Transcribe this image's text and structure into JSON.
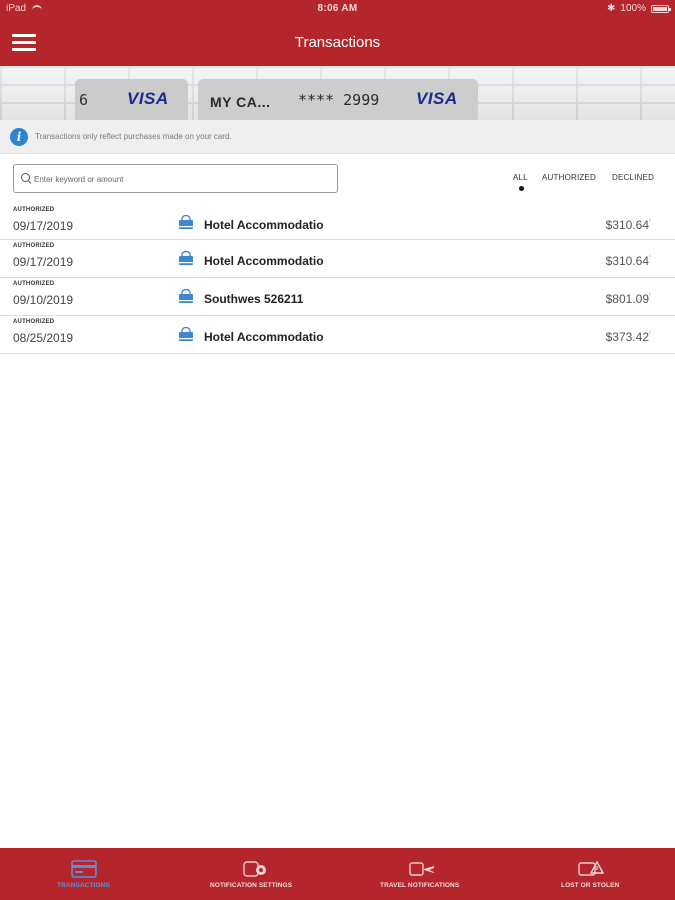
{
  "status_bar": {
    "device": "iPad",
    "time": "8:06 AM",
    "battery": "100%"
  },
  "nav": {
    "title": "Transactions"
  },
  "cards": {
    "previous": {
      "last_digit": "6",
      "brand": "VISA"
    },
    "current": {
      "name": "MY CA...",
      "number": "**** 2999",
      "brand": "VISA"
    }
  },
  "info": {
    "text": "Transactions only reflect purchases made on your card."
  },
  "search": {
    "placeholder": "Enter keyword or amount",
    "value": ""
  },
  "filters": {
    "tabs": [
      "ALL",
      "AUTHORIZED",
      "DECLINED"
    ],
    "active": "ALL"
  },
  "transactions": [
    {
      "status": "AUTHORIZED",
      "date": "09/17/2019",
      "merchant": "Hotel Accommodatio",
      "amount": "$310.64"
    },
    {
      "status": "AUTHORIZED",
      "date": "09/17/2019",
      "merchant": "Hotel Accommodatio",
      "amount": "$310.64"
    },
    {
      "status": "AUTHORIZED",
      "date": "09/10/2019",
      "merchant": "Southwes 526211",
      "amount": "$801.09"
    },
    {
      "status": "AUTHORIZED",
      "date": "08/25/2019",
      "merchant": "Hotel Accommodatio",
      "amount": "$373.42"
    }
  ],
  "tab_bar": {
    "items": [
      {
        "label": "TRANSACTIONS",
        "icon": "card-icon",
        "active": true
      },
      {
        "label": "NOTIFICATION SETTINGS",
        "icon": "notification-settings-icon",
        "active": false
      },
      {
        "label": "TRAVEL NOTIFICATIONS",
        "icon": "travel-plane-icon",
        "active": false
      },
      {
        "label": "LOST OR STOLEN",
        "icon": "lost-stolen-warning-icon",
        "active": false
      }
    ]
  },
  "colors": {
    "brand_red": "#b5262c",
    "info_blue": "#2a86d1",
    "active_tab": "#5c8ed8",
    "visa_blue": "#1a2b8c"
  }
}
